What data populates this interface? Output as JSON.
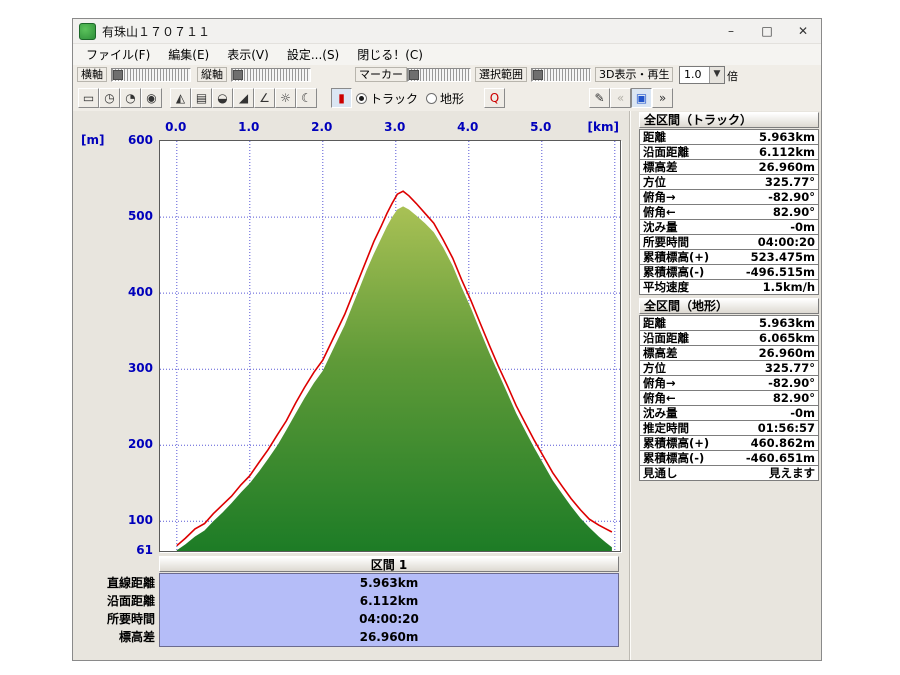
{
  "window": {
    "title": "有珠山１７０７１１",
    "minimize_glyph": "–",
    "maximize_glyph": "□",
    "close_glyph": "✕"
  },
  "menu": {
    "items": [
      {
        "id": "file",
        "label": "ファイル(F)"
      },
      {
        "id": "edit",
        "label": "編集(E)"
      },
      {
        "id": "view",
        "label": "表示(V)"
      },
      {
        "id": "settings",
        "label": "設定...(S)"
      },
      {
        "id": "close",
        "label": "閉じる！(C)"
      }
    ]
  },
  "toolbar_sliders": {
    "h_axis": "横軸",
    "v_axis": "縦軸",
    "marker": "マーカー",
    "selection": "選択範囲",
    "playback_3d": "3D表示・再生",
    "scale_value": "1.0",
    "scale_unit": "倍"
  },
  "toolbar_buttons": {
    "groups": [
      {
        "name": "time-display-group",
        "buttons": [
          {
            "name": "distance-axis-icon",
            "glyph": "▭"
          },
          {
            "name": "clock-icon",
            "glyph": "◷"
          },
          {
            "name": "clock-digits-icon",
            "glyph": "◔"
          },
          {
            "name": "stopwatch-icon",
            "glyph": "◉"
          }
        ]
      },
      {
        "name": "graph-tools-group",
        "buttons": [
          {
            "name": "profile-graph-icon",
            "glyph": "◭"
          },
          {
            "name": "ruler-icon",
            "glyph": "▤"
          },
          {
            "name": "gauge-icon",
            "glyph": "◒"
          },
          {
            "name": "slope-icon",
            "glyph": "◢"
          },
          {
            "name": "angle-icon",
            "glyph": "∠"
          },
          {
            "name": "sun-icon",
            "glyph": "☼"
          },
          {
            "name": "moon-icon",
            "glyph": "☾"
          }
        ]
      },
      {
        "name": "marker-group",
        "buttons": [
          {
            "name": "thermometer-icon",
            "glyph": "▮",
            "color": "#cc0000",
            "pressed": true
          }
        ]
      },
      {
        "name": "radio-group",
        "radios": [
          {
            "name": "radio-track",
            "label": "トラック",
            "selected": true
          },
          {
            "name": "radio-terrain",
            "label": "地形",
            "selected": false
          }
        ]
      },
      {
        "name": "zoom-group",
        "buttons": [
          {
            "name": "marker-search-icon",
            "glyph": "Q",
            "color": "#cc0000"
          }
        ]
      },
      {
        "name": "playback-group",
        "buttons": [
          {
            "name": "pen-off-icon",
            "glyph": "✎"
          },
          {
            "name": "rewind-icon",
            "glyph": "«",
            "disabled": true
          },
          {
            "name": "stop-icon",
            "glyph": "▣",
            "pressed": true,
            "color": "#2255cc"
          },
          {
            "name": "play-icon",
            "glyph": "»"
          }
        ]
      }
    ]
  },
  "section_panel": {
    "header": "区間 1",
    "rows": [
      {
        "label": "直線距離",
        "value": "5.963km"
      },
      {
        "label": "沿面距離",
        "value": "6.112km"
      },
      {
        "label": "所要時間",
        "value": "04:00:20"
      },
      {
        "label": "標高差",
        "value": "26.960m"
      }
    ]
  },
  "track_panel": {
    "title": "全区間（トラック）",
    "rows": [
      {
        "label": "距離",
        "value": "5.963km"
      },
      {
        "label": "沿面距離",
        "value": "6.112km"
      },
      {
        "label": "標高差",
        "value": "26.960m"
      },
      {
        "label": "方位",
        "value": "325.77°"
      },
      {
        "label": "俯角→",
        "value": "-82.90°"
      },
      {
        "label": "俯角←",
        "value": "82.90°"
      },
      {
        "label": "沈み量",
        "value": "-0m"
      },
      {
        "label": "所要時間",
        "value": "04:00:20"
      },
      {
        "label": "累積標高(+)",
        "value": "523.475m"
      },
      {
        "label": "累積標高(-)",
        "value": "-496.515m"
      },
      {
        "label": "平均速度",
        "value": "1.5km/h"
      }
    ]
  },
  "terrain_panel": {
    "title": "全区間（地形）",
    "rows": [
      {
        "label": "距離",
        "value": "5.963km"
      },
      {
        "label": "沿面距離",
        "value": "6.065km"
      },
      {
        "label": "標高差",
        "value": "26.960m"
      },
      {
        "label": "方位",
        "value": "325.77°"
      },
      {
        "label": "俯角→",
        "value": "-82.90°"
      },
      {
        "label": "俯角←",
        "value": "82.90°"
      },
      {
        "label": "沈み量",
        "value": "-0m"
      },
      {
        "label": "推定時間",
        "value": "01:56:57"
      },
      {
        "label": "累積標高(+)",
        "value": "460.862m"
      },
      {
        "label": "累積標高(-)",
        "value": "-460.651m"
      },
      {
        "label": "見通し",
        "value": "見えます"
      }
    ]
  },
  "chart_data": {
    "type": "area",
    "xlabel": "[km]",
    "ylabel": "[m]",
    "xlim": [
      0,
      6.0
    ],
    "ylim": [
      61,
      600
    ],
    "grid": true,
    "x_tick_values": [
      0,
      1,
      2,
      3,
      4,
      5
    ],
    "x_ticks": [
      "0.0",
      "1.0",
      "2.0",
      "3.0",
      "4.0",
      "5.0"
    ],
    "y_tick_values": [
      600,
      500,
      400,
      300,
      200,
      100,
      61
    ],
    "y_ticks": [
      "600",
      "500",
      "400",
      "300",
      "200",
      "100",
      "61"
    ],
    "series": [
      {
        "name": "track",
        "type": "line",
        "color": "#dd0000",
        "x": [
          0.0,
          0.12,
          0.25,
          0.38,
          0.5,
          0.63,
          0.75,
          0.88,
          1.0,
          1.13,
          1.25,
          1.38,
          1.5,
          1.63,
          1.75,
          1.88,
          2.0,
          2.1,
          2.2,
          2.3,
          2.4,
          2.5,
          2.6,
          2.7,
          2.8,
          2.88,
          2.95,
          3.02,
          3.1,
          3.18,
          3.28,
          3.4,
          3.52,
          3.65,
          3.78,
          3.9,
          4.03,
          4.15,
          4.28,
          4.4,
          4.53,
          4.65,
          4.78,
          4.9,
          5.03,
          5.15,
          5.28,
          5.4,
          5.53,
          5.65,
          5.78,
          5.88,
          5.96
        ],
        "y": [
          68,
          78,
          90,
          97,
          110,
          122,
          133,
          148,
          160,
          178,
          194,
          214,
          232,
          256,
          276,
          296,
          312,
          332,
          352,
          372,
          396,
          420,
          444,
          468,
          488,
          505,
          518,
          530,
          534,
          528,
          518,
          505,
          492,
          470,
          446,
          418,
          390,
          362,
          332,
          305,
          278,
          252,
          228,
          206,
          184,
          164,
          146,
          130,
          115,
          103,
          95,
          90,
          86
        ]
      },
      {
        "name": "terrain",
        "type": "area",
        "fill_colors": [
          "#a9c155",
          "#5f9a38",
          "#1d7c26"
        ],
        "x": [
          0.0,
          0.12,
          0.25,
          0.38,
          0.5,
          0.63,
          0.75,
          0.88,
          1.0,
          1.13,
          1.25,
          1.38,
          1.5,
          1.63,
          1.75,
          1.88,
          2.0,
          2.1,
          2.2,
          2.3,
          2.4,
          2.5,
          2.6,
          2.7,
          2.8,
          2.88,
          2.95,
          3.02,
          3.1,
          3.18,
          3.28,
          3.4,
          3.52,
          3.65,
          3.78,
          3.9,
          4.03,
          4.15,
          4.28,
          4.4,
          4.53,
          4.65,
          4.78,
          4.9,
          5.03,
          5.15,
          5.28,
          5.4,
          5.53,
          5.65,
          5.78,
          5.88,
          5.96
        ],
        "y": [
          62,
          70,
          80,
          88,
          100,
          112,
          124,
          138,
          150,
          166,
          182,
          200,
          220,
          242,
          262,
          282,
          298,
          318,
          338,
          358,
          382,
          406,
          430,
          452,
          472,
          488,
          500,
          510,
          514,
          510,
          502,
          492,
          480,
          460,
          436,
          408,
          380,
          352,
          322,
          296,
          268,
          242,
          218,
          196,
          174,
          154,
          136,
          120,
          104,
          92,
          80,
          72,
          66
        ]
      }
    ]
  }
}
